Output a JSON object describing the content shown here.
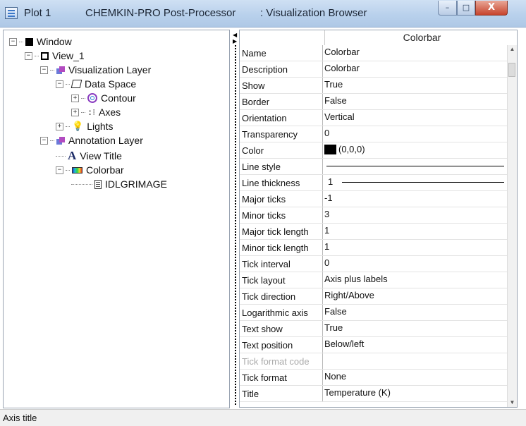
{
  "titlebar": {
    "plot": "Plot 1",
    "app": "CHEMKIN-PRO Post-Processor",
    "view": ": Visualization Browser",
    "minimize": "–",
    "maximize": "□",
    "close": "X"
  },
  "tree": {
    "items": [
      {
        "label": "Window",
        "icon": "window-icon",
        "pm": "−"
      },
      {
        "label": "View_1",
        "icon": "view-icon",
        "pm": "−"
      },
      {
        "label": "Visualization Layer",
        "icon": "layer-icon",
        "pm": "−"
      },
      {
        "label": "Data Space",
        "icon": "data-space-icon",
        "pm": "−"
      },
      {
        "label": "Contour",
        "icon": "contour-icon",
        "pm": "+"
      },
      {
        "label": "Axes",
        "icon": "axes-icon",
        "pm": "+"
      },
      {
        "label": "Lights",
        "icon": "lightbulb-icon",
        "pm": "+"
      },
      {
        "label": "Annotation Layer",
        "icon": "layer-icon",
        "pm": "−"
      },
      {
        "label": "View Title",
        "icon": "text-icon",
        "pm": ""
      },
      {
        "label": "Colorbar",
        "icon": "colorbar-icon",
        "pm": "−"
      },
      {
        "label": "IDLGRIMAGE",
        "icon": "image-icon",
        "pm": ""
      }
    ]
  },
  "grid": {
    "header": "Colorbar",
    "properties": [
      {
        "name": "Name",
        "value": "Colorbar"
      },
      {
        "name": "Description",
        "value": "Colorbar"
      },
      {
        "name": "Show",
        "value": "True"
      },
      {
        "name": "Border",
        "value": "False"
      },
      {
        "name": "Orientation",
        "value": "Vertical"
      },
      {
        "name": "Transparency",
        "value": "0"
      },
      {
        "name": "Color",
        "value": "(0,0,0)"
      },
      {
        "name": "Line style",
        "value": ""
      },
      {
        "name": "Line thickness",
        "value": "1"
      },
      {
        "name": "Major ticks",
        "value": "-1"
      },
      {
        "name": "Minor ticks",
        "value": "3"
      },
      {
        "name": "Major tick length",
        "value": "1"
      },
      {
        "name": "Minor tick length",
        "value": "1"
      },
      {
        "name": "Tick interval",
        "value": "0"
      },
      {
        "name": "Tick layout",
        "value": "Axis plus labels"
      },
      {
        "name": "Tick direction",
        "value": "Right/Above"
      },
      {
        "name": "Logarithmic axis",
        "value": "False"
      },
      {
        "name": "Text show",
        "value": "True"
      },
      {
        "name": "Text position",
        "value": "Below/left"
      },
      {
        "name": "Tick format code",
        "value": "",
        "disabled": true
      },
      {
        "name": "Tick format",
        "value": "None"
      },
      {
        "name": "Title",
        "value": "Temperature (K)"
      }
    ]
  },
  "statusbar": {
    "text": "Axis title"
  },
  "colors": {
    "titlebar": "#b9d1ec",
    "close_button": "#c7442d",
    "swatch": "#000000"
  }
}
